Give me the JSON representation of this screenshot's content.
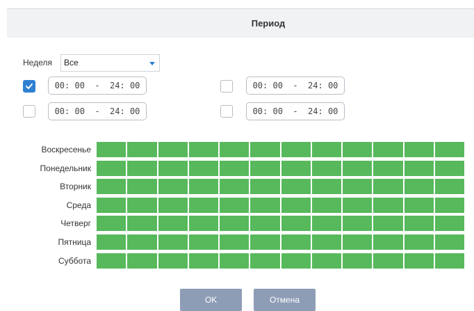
{
  "dialog": {
    "title": "Период"
  },
  "week": {
    "label": "Неделя",
    "value": "Все"
  },
  "periods": [
    {
      "checked": true,
      "text": "00: 00  -  24: 00"
    },
    {
      "checked": false,
      "text": "00: 00  -  24: 00"
    },
    {
      "checked": false,
      "text": "00: 00  -  24: 00"
    },
    {
      "checked": false,
      "text": "00: 00  -  24: 00"
    }
  ],
  "days": [
    {
      "label": "Воскресенье"
    },
    {
      "label": "Понедельник"
    },
    {
      "label": "Вторник"
    },
    {
      "label": "Среда"
    },
    {
      "label": "Четверг"
    },
    {
      "label": "Пятница"
    },
    {
      "label": "Суббота"
    }
  ],
  "schedule": {
    "columns": 12,
    "all_selected": true,
    "fill_color": "#57b95b"
  },
  "buttons": {
    "ok": "OK",
    "cancel": "Отмена"
  },
  "colors": {
    "accent": "#2f80d0",
    "button": "#8d9db6",
    "header": "#f1f2f4"
  }
}
